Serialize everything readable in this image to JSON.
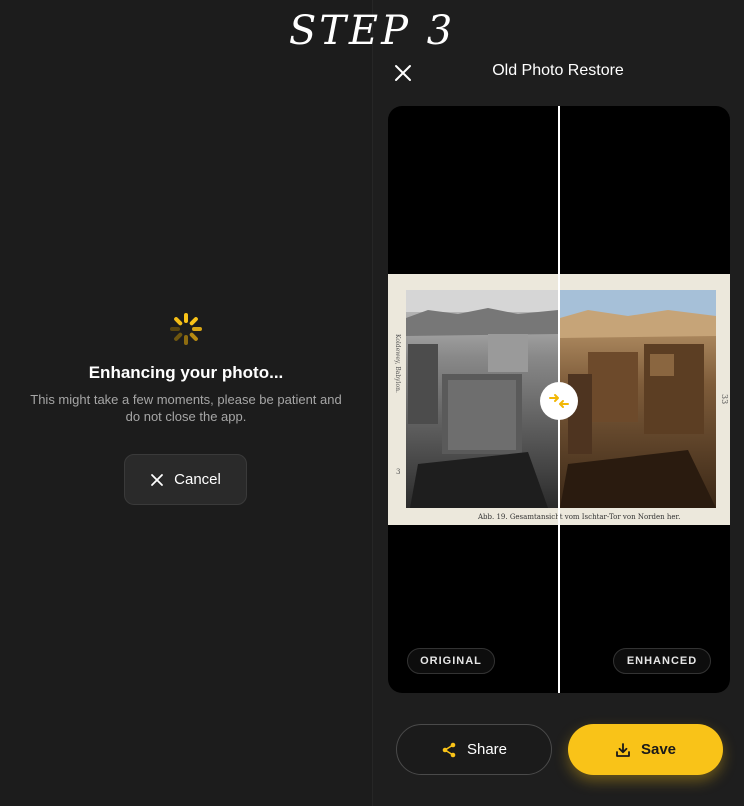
{
  "banner": {
    "title": "STEP 3"
  },
  "progress": {
    "title": "Enhancing your photo...",
    "subtitle": "This might take a few moments, please be patient and do not close the app.",
    "cancel_label": "Cancel"
  },
  "header": {
    "title": "Old Photo Restore"
  },
  "compare": {
    "original_label": "ORIGINAL",
    "enhanced_label": "ENHANCED",
    "caption": "Abb. 19. Gesamtansicht vom Ischtar-Tor von Norden her.",
    "page_number": "33"
  },
  "actions": {
    "share_label": "Share",
    "save_label": "Save"
  },
  "colors": {
    "accent": "#f9c318",
    "background": "#1c1c1c",
    "sky": "#a6c0d8"
  },
  "icons": {
    "spinner": "loading-spinner-icon",
    "cancel": "close-icon",
    "close": "close-icon",
    "compare": "swap-arrows-icon",
    "share": "share-icon",
    "save": "download-icon"
  }
}
